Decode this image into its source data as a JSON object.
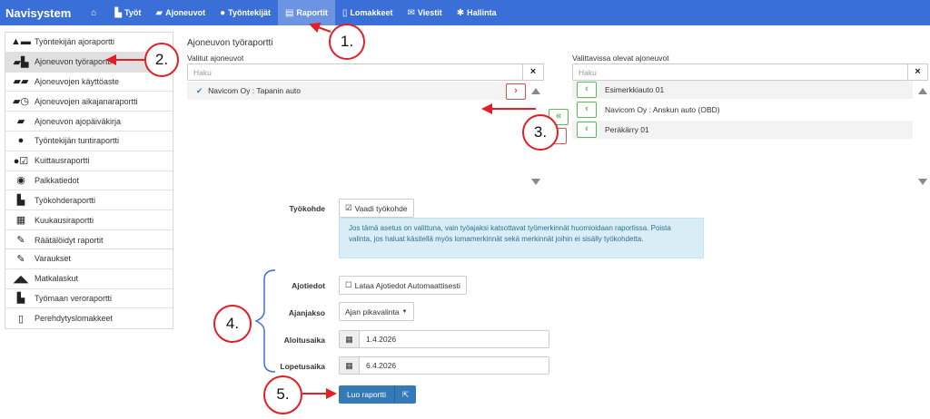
{
  "nav": {
    "brand": "Navisystem",
    "home_icon": "home-icon",
    "items": [
      {
        "label": "Työt",
        "icon": "chart-icon"
      },
      {
        "label": "Ajoneuvot",
        "icon": "vehicle-icon"
      },
      {
        "label": "Työntekijät",
        "icon": "user-icon"
      },
      {
        "label": "Raportit",
        "icon": "report-icon",
        "active": true
      },
      {
        "label": "Lomakkeet",
        "icon": "document-icon"
      },
      {
        "label": "Viestit",
        "icon": "envelope-icon"
      },
      {
        "label": "Hallinta",
        "icon": "gear-icon"
      }
    ]
  },
  "sidebar": {
    "group1": [
      {
        "label": "Työntekijän ajoraportti",
        "icon": "driver-icon"
      },
      {
        "label": "Ajoneuvon työraportti",
        "icon": "vehicle-chart-icon",
        "active": true
      },
      {
        "label": "Ajoneuvojen käyttöaste",
        "icon": "vehicles-icon"
      },
      {
        "label": "Ajoneuvojen aikajanaraportti",
        "icon": "timeline-icon"
      },
      {
        "label": "Ajoneuvon ajopäiväkirja",
        "icon": "truck-icon"
      },
      {
        "label": "Työntekijän tuntiraportti",
        "icon": "person-icon"
      },
      {
        "label": "Kuittausraportti",
        "icon": "user-check-icon"
      },
      {
        "label": "Palkkatiedot",
        "icon": "piggy-bank-icon"
      },
      {
        "label": "Työkohderaportti",
        "icon": "factory-icon"
      },
      {
        "label": "Kuukausiraportti",
        "icon": "calendar-icon"
      },
      {
        "label": "Räätälöidyt raportit",
        "icon": "pencil-icon"
      }
    ],
    "group2": [
      {
        "label": "Varaukset",
        "icon": "pin-icon"
      },
      {
        "label": "Matkalaskut",
        "icon": "road-icon"
      },
      {
        "label": "Työmaan veroraportti",
        "icon": "factory-icon"
      },
      {
        "label": "Perehdytyslomakkeet",
        "icon": "document-icon"
      }
    ]
  },
  "main": {
    "title": "Ajoneuvon työraportti",
    "selected_label": "Valitut ajoneuvot",
    "search_placeholder": "Haku",
    "clear": "×",
    "selected_vehicles": [
      "Navicom Oy : Tapanin auto"
    ],
    "available_label": "Valittavissa olevat ajoneuvot",
    "available_vehicles": [
      "Esimerkkiauto 01",
      "Navicom Oy : Anskun auto (OBD)",
      "Peräkärry 01"
    ],
    "move_right": "›",
    "move_left": "‹",
    "move_all_left": "«",
    "worksite_label": "Työkohde",
    "worksite_button": "Vaadi työkohde",
    "info_text": "Jos tämä asetus on valittuna, vain työajaksi katsottavat työmerkinnät huomioidaan raportissa. Poista valinta, jos haluat käsitellä myös lomamerkinnät sekä merkinnät joihin ei sisälly työkohdetta.",
    "trip_label": "Ajotiedot",
    "trip_button": "Lataa Ajotiedot Automaattisesti",
    "period_label": "Ajanjakso",
    "period_button": "Ajan pikavalinta",
    "start_label": "Aloitusaika",
    "start_value": "1.4.2026",
    "end_label": "Lopetusaika",
    "end_value": "6.4.2026",
    "create_button": "Luo raportti"
  },
  "annotations": [
    "1.",
    "2.",
    "3.",
    "4.",
    "5."
  ],
  "colors": {
    "nav": "#3b6fd8",
    "nav_active": "#6d93e3",
    "primary": "#337ab7",
    "annotation": "#e31e24",
    "info_bg": "#d9edf7"
  }
}
